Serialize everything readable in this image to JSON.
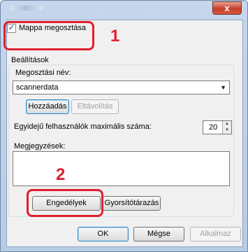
{
  "window": {
    "close_label": "x"
  },
  "share": {
    "checkbox_checked": true,
    "checkbox_mark": "✓",
    "checkbox_label": "Mappa megosztása"
  },
  "settings": {
    "group_label": "Beállítások",
    "share_name_label": "Megosztási név:",
    "share_name_value": "scannerdata",
    "add_button": "Hozzáadás",
    "remove_button": "Eltávolítás",
    "max_users_label": "Egyidejű felhasználók maximális száma:",
    "max_users_value": "20",
    "comments_label": "Megjegyzések:",
    "permissions_button": "Engedélyek",
    "caching_button": "Gyorsítótárazás"
  },
  "footer": {
    "ok_button": "OK",
    "cancel_button": "Mégse",
    "apply_button": "Alkalmaz"
  },
  "annotations": {
    "step1": "1",
    "step2": "2",
    "color": "#e0202e"
  }
}
